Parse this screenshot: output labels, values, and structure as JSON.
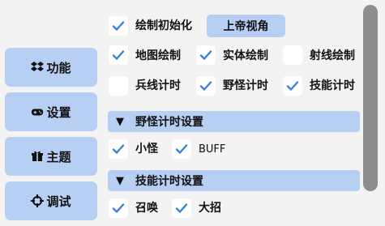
{
  "sidebar": {
    "items": [
      {
        "label": "功能",
        "icon": "dropbox-icon"
      },
      {
        "label": "设置",
        "icon": "gamepad-icon"
      },
      {
        "label": "主题",
        "icon": "gift-icon"
      },
      {
        "label": "调试",
        "icon": "crosshair-icon"
      }
    ]
  },
  "options": {
    "init_draw": {
      "label": "绘制初始化",
      "checked": true
    },
    "god_view_button": "上帝视角",
    "map_draw": {
      "label": "地图绘制",
      "checked": true
    },
    "entity_draw": {
      "label": "实体绘制",
      "checked": true
    },
    "ray_draw": {
      "label": "射线绘制",
      "checked": false
    },
    "minion_timer": {
      "label": "兵线计时",
      "checked": false
    },
    "jungle_timer": {
      "label": "野怪计时",
      "checked": true
    },
    "skill_timer": {
      "label": "技能计时",
      "checked": true
    }
  },
  "sections": {
    "jungle": {
      "title": "野怪计时设置",
      "small_monster": {
        "label": "小怪",
        "checked": true
      },
      "buff": {
        "label": "BUFF",
        "checked": true
      }
    },
    "skill": {
      "title": "技能计时设置",
      "summon": {
        "label": "召唤",
        "checked": true
      },
      "ultimate": {
        "label": "大招",
        "checked": true
      }
    }
  },
  "colors": {
    "accent": "#b7cff2",
    "check": "#3b82d6",
    "background": "#f3f3f3",
    "scrollbar": "#8d8d8d"
  }
}
